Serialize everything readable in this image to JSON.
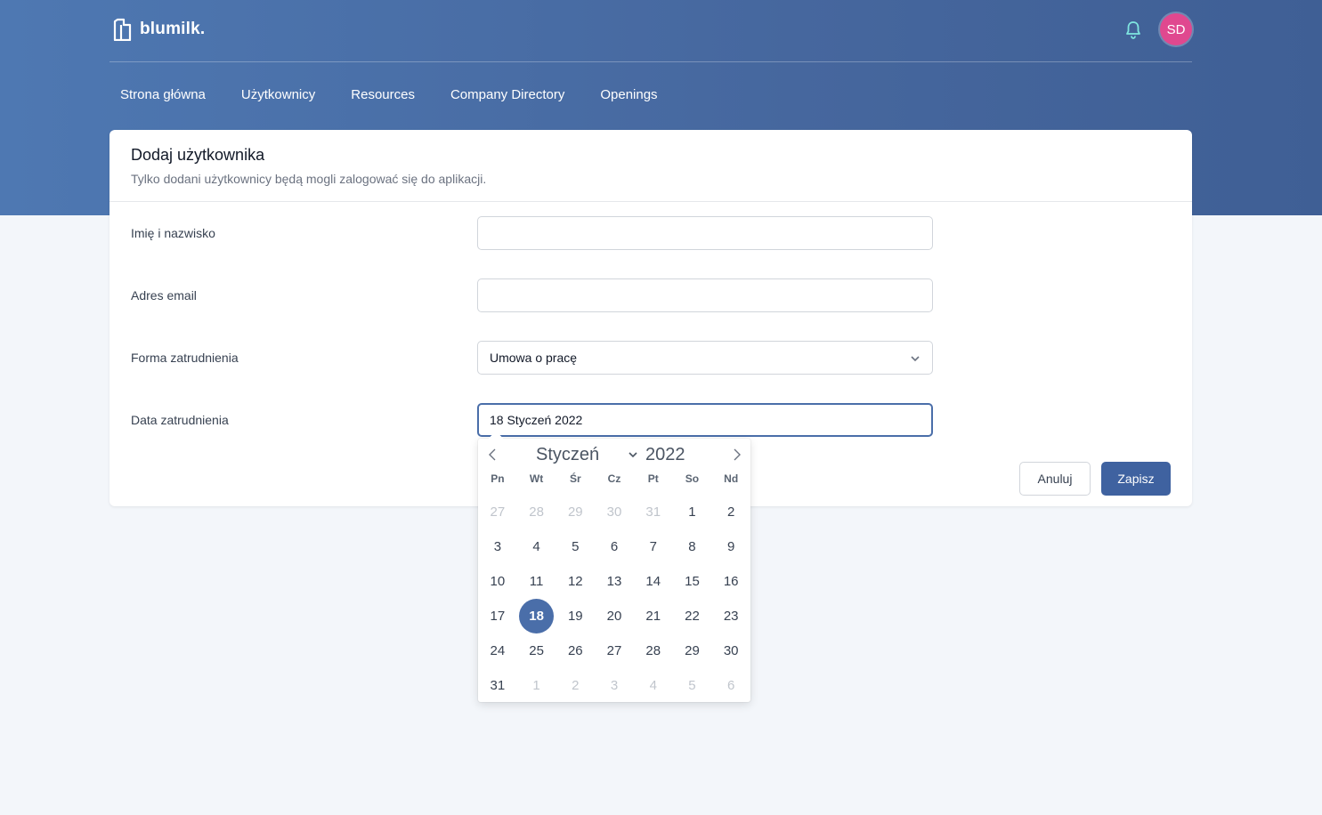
{
  "header": {
    "logo_text": "blumilk.",
    "avatar_initials": "SD",
    "bell_icon": "bell-icon"
  },
  "nav": {
    "items": [
      {
        "label": "Strona główna"
      },
      {
        "label": "Użytkownicy"
      },
      {
        "label": "Resources"
      },
      {
        "label": "Company Directory"
      },
      {
        "label": "Openings"
      }
    ]
  },
  "form": {
    "title": "Dodaj użytkownika",
    "subtitle": "Tylko dodani użytkownicy będą mogli zalogować się do aplikacji.",
    "fields": {
      "name": {
        "label": "Imię i nazwisko",
        "value": ""
      },
      "email": {
        "label": "Adres email",
        "value": ""
      },
      "employment": {
        "label": "Forma zatrudnienia",
        "value": "Umowa o pracę"
      },
      "date": {
        "label": "Data zatrudnienia",
        "value": "18 Styczeń 2022"
      }
    },
    "cancel_label": "Anuluj",
    "save_label": "Zapisz"
  },
  "datepicker": {
    "month": "Styczeń",
    "year": "2022",
    "weekdays": [
      "Pn",
      "Wt",
      "Śr",
      "Cz",
      "Pt",
      "So",
      "Nd"
    ],
    "selected": "18",
    "weeks": [
      [
        {
          "d": "27",
          "m": true
        },
        {
          "d": "28",
          "m": true
        },
        {
          "d": "29",
          "m": true
        },
        {
          "d": "30",
          "m": true
        },
        {
          "d": "31",
          "m": true
        },
        {
          "d": "1"
        },
        {
          "d": "2"
        }
      ],
      [
        {
          "d": "3"
        },
        {
          "d": "4"
        },
        {
          "d": "5"
        },
        {
          "d": "6"
        },
        {
          "d": "7"
        },
        {
          "d": "8"
        },
        {
          "d": "9"
        }
      ],
      [
        {
          "d": "10"
        },
        {
          "d": "11"
        },
        {
          "d": "12"
        },
        {
          "d": "13"
        },
        {
          "d": "14"
        },
        {
          "d": "15"
        },
        {
          "d": "16"
        }
      ],
      [
        {
          "d": "17"
        },
        {
          "d": "18",
          "s": true
        },
        {
          "d": "19"
        },
        {
          "d": "20"
        },
        {
          "d": "21"
        },
        {
          "d": "22"
        },
        {
          "d": "23"
        }
      ],
      [
        {
          "d": "24"
        },
        {
          "d": "25"
        },
        {
          "d": "26"
        },
        {
          "d": "27"
        },
        {
          "d": "28"
        },
        {
          "d": "29"
        },
        {
          "d": "30"
        }
      ],
      [
        {
          "d": "31"
        },
        {
          "d": "1",
          "m": true
        },
        {
          "d": "2",
          "m": true
        },
        {
          "d": "3",
          "m": true
        },
        {
          "d": "4",
          "m": true
        },
        {
          "d": "5",
          "m": true
        },
        {
          "d": "6",
          "m": true
        }
      ]
    ]
  },
  "colors": {
    "header_bg": "#4a6ea9",
    "primary": "#3f62a0",
    "avatar_bg": "#e0488f",
    "bell": "#7fe6e0"
  }
}
